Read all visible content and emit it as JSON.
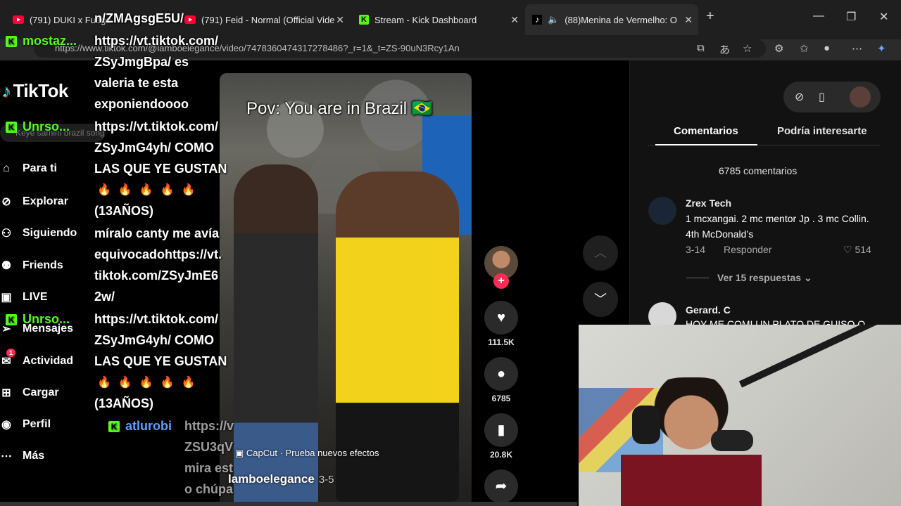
{
  "browser": {
    "tabs": [
      {
        "title": "(791) DUKI x Fuego",
        "icon": "youtube-icon"
      },
      {
        "title": "(791) Feid - Normal (Official Vide",
        "icon": "youtube-icon"
      },
      {
        "title": "Stream - Kick Dashboard",
        "icon": "kick-icon"
      },
      {
        "title": "(88)Menina de Vermelho: O",
        "icon": "tiktok-icon"
      }
    ],
    "url": "https://www.tiktok.com/@lamboelegance/video/7478360474317278486?_r=1&_t=ZS-90uN3Rcy1An"
  },
  "sidebar": {
    "logo": "TikTok",
    "search_placeholder": "Keyé samini brazil song",
    "items": [
      {
        "label": "Para ti",
        "icon": "home-icon"
      },
      {
        "label": "Explorar",
        "icon": "compass-icon"
      },
      {
        "label": "Siguiendo",
        "icon": "following-icon"
      },
      {
        "label": "Friends",
        "icon": "friends-icon"
      },
      {
        "label": "LIVE",
        "icon": "live-icon"
      },
      {
        "label": "Mensajes",
        "icon": "send-icon"
      },
      {
        "label": "Actividad",
        "icon": "inbox-icon",
        "badge": "1"
      },
      {
        "label": "Cargar",
        "icon": "upload-icon"
      },
      {
        "label": "Perfil",
        "icon": "profile-icon"
      },
      {
        "label": "Más",
        "icon": "more-icon"
      }
    ]
  },
  "video": {
    "caption": "Pov: You are in Brazil 🇧🇷",
    "capcut": "CapCut · Prueba nuevos efectos",
    "author": "lamboelegance",
    "date": "3-5",
    "likes": "111.5K",
    "comments": "6785",
    "saves": "20.8K"
  },
  "comments_panel": {
    "tab_comments": "Comentarios",
    "tab_related": "Podría interesarte",
    "count": "6785 comentarios",
    "comments": [
      {
        "user": "Zrex Tech",
        "text": "1 mcxangai. 2 mc mentor Jp . 3 mc Collin. 4th McDonald’s",
        "date": "3-14",
        "reply": "Responder",
        "likes": "514",
        "view_replies": "Ver 15 respuestas"
      },
      {
        "user": "Gerard. C",
        "text": "HOY ME COMI UN PLATO DE GUISO O"
      }
    ]
  },
  "chat": {
    "users": [
      "mostaz...",
      "Unrso...",
      "Unrso...",
      "atlurobi"
    ],
    "lines": [
      "n/ZMAgsgE5U/",
      "https://vt.tiktok.com/",
      "ZSyJmgBpa/ es",
      "valeria te esta",
      "exponiendoooo",
      "https://vt.tiktok.com/",
      "ZSyJmG4yh/ COMO",
      "LAS QUE YE GUSTAN",
      "(13AÑOS)",
      "míralo canty me avía",
      "equivocadohttps://vt.",
      "tiktok.com/ZSyJmE6",
      "2w/",
      "https://vt.tiktok.com/",
      "ZSyJmG4yh/ COMO",
      "LAS QUE YE GUSTAN",
      "(13AÑOS)",
      "https://v",
      "ZSU3qV",
      "mira est",
      "o chúpa"
    ]
  }
}
